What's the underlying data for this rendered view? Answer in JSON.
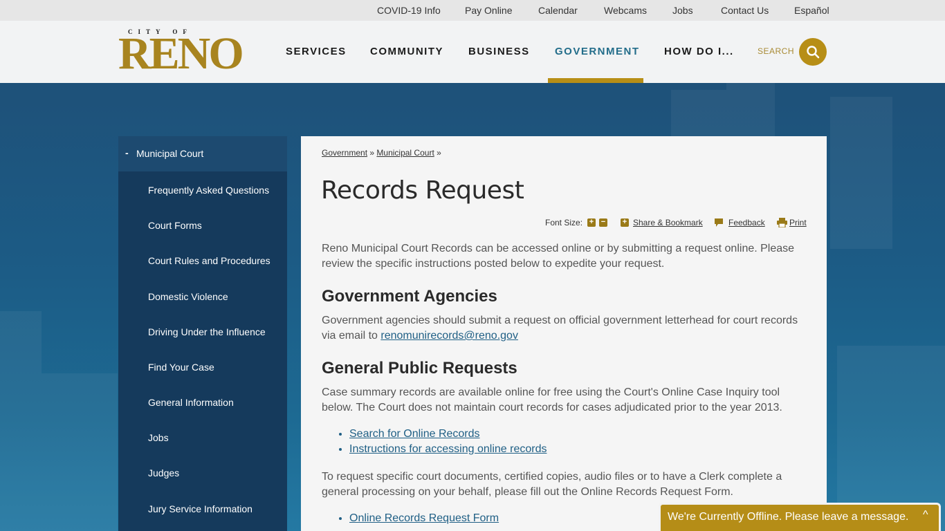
{
  "utility": [
    "COVID-19 Info",
    "Pay Online",
    "Calendar",
    "Webcams",
    "Jobs",
    "Contact Us",
    "Español"
  ],
  "logo": {
    "top": "CITY OF",
    "main": "RENO"
  },
  "nav": [
    "SERVICES",
    "COMMUNITY",
    "BUSINESS",
    "GOVERNMENT",
    "HOW DO I..."
  ],
  "nav_active": "GOVERNMENT",
  "search_label": "SEARCH",
  "sidebar": {
    "heading": "Municipal Court",
    "items": [
      "Frequently Asked Questions",
      "Court Forms",
      "Court Rules and Procedures",
      "Domestic Violence",
      "Driving Under the Influence",
      "Find Your Case",
      "General Information",
      "Jobs",
      "Judges",
      "Jury Service Information"
    ]
  },
  "breadcrumb": {
    "first": "Government",
    "sep1": "»",
    "second": "Municipal Court",
    "sep2": "»"
  },
  "page_title": "Records Request",
  "tools": {
    "font_size": "Font Size:",
    "share": "Share & Bookmark",
    "feedback": "Feedback",
    "print": "Print"
  },
  "intro": "Reno Municipal Court Records can be accessed online or by submitting a request online. Please review the specific instructions posted below to expedite your request.",
  "section1": {
    "heading": "Government Agencies",
    "text": "Government agencies should submit a request on official government letterhead for court records via email to",
    "email": "renomunirecords@reno.gov"
  },
  "section2": {
    "heading": "General Public Requests",
    "text": "Case summary records are available online for free using the Court's Online Case Inquiry tool below. The Court does not maintain court records for cases adjudicated prior to the year 2013.",
    "links": [
      "Search for Online Records ",
      "Instructions for accessing online records"
    ],
    "text2": "To request specific court documents, certified copies, audio files or to have a Clerk complete a general processing on your behalf, please fill out the Online Records Request Form.",
    "links2": [
      "Online Records Request Form"
    ]
  },
  "chat": {
    "message": "We're Currently Offline. Please leave a message.",
    "caret": "^"
  },
  "colors": {
    "gold": "#b78e16",
    "nav_active": "#236d8a",
    "sidebar": "#153a5c",
    "link": "#1f5f85"
  }
}
